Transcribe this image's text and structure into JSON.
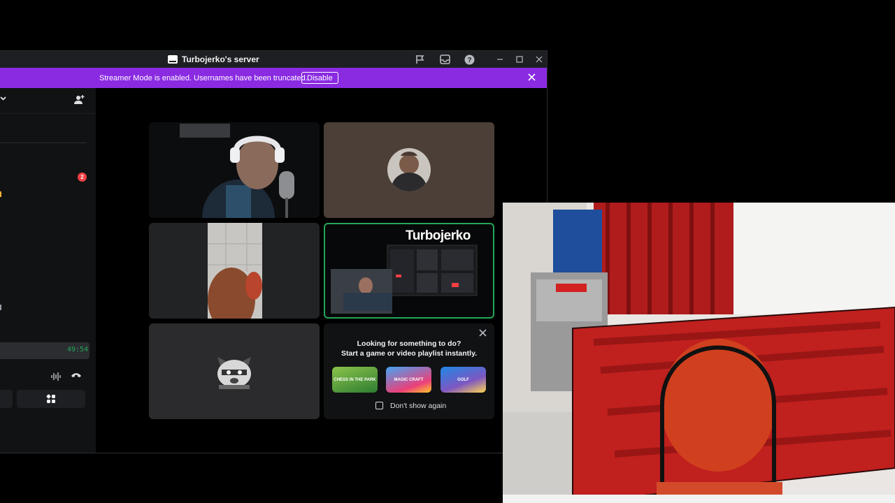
{
  "window": {
    "title": "Turbojerko's server",
    "banner_text": "Streamer Mode is enabled. Usernames have been truncated.",
    "banner_button": "Disable"
  },
  "icons": {
    "server": "server-icon",
    "inbox": "inbox-icon",
    "threads": "threads-icon",
    "help": "help-icon",
    "minimize": "minimize-icon",
    "maximize": "maximize-icon",
    "close": "close-icon",
    "invite": "add-member-icon",
    "soundboard": "soundboard-icon",
    "disconnect": "disconnect-icon",
    "activity": "activity-icon",
    "mic": "mic-icon",
    "headphones": "headphones-icon",
    "settings": "gear-icon"
  },
  "sidebar": {
    "mention_badge": "2",
    "call_timer": "49:54"
  },
  "stage": {
    "stream_overlay_name": "Turbojerko"
  },
  "activity_card": {
    "line1": "Looking for something to do?",
    "line2": "Start a game or video playlist instantly.",
    "games": [
      "CHESS IN THE PARK",
      "MAGIC CRAFT",
      "GOLF"
    ],
    "dont_show_label": "Don't show again"
  },
  "colors": {
    "banner": "#8a2be2",
    "speaking_border": "#23a559",
    "badge": "#f23f43",
    "timer": "#23a559"
  }
}
